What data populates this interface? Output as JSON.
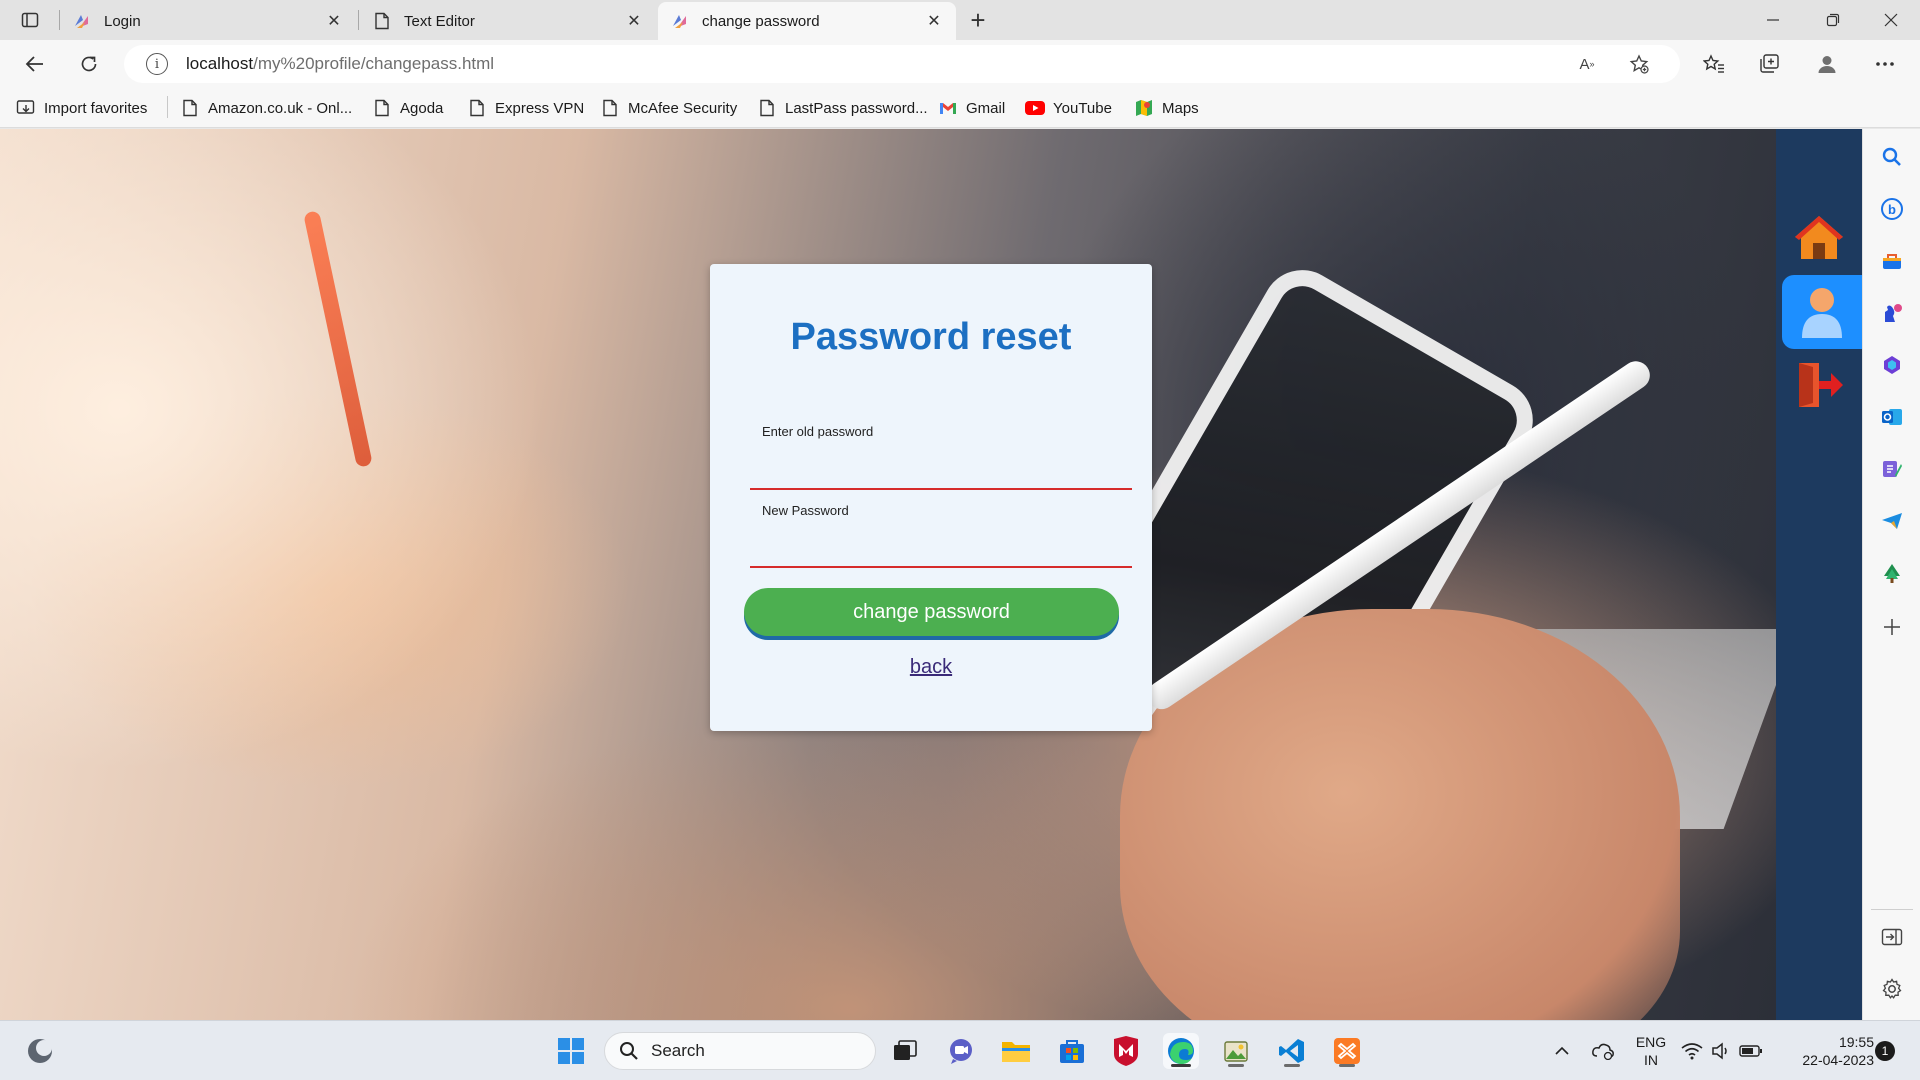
{
  "browser": {
    "tabs": [
      {
        "title": "Login",
        "active": false
      },
      {
        "title": "Text Editor",
        "active": false
      },
      {
        "title": "change password",
        "active": true
      }
    ],
    "address": {
      "host": "localhost",
      "path": "/my%20profile/changepass.html"
    },
    "favorites": [
      {
        "label": "Import favorites",
        "icon": "import-icon"
      },
      {
        "label": "Amazon.co.uk - Onl...",
        "icon": "page-icon"
      },
      {
        "label": "Agoda",
        "icon": "page-icon"
      },
      {
        "label": "Express VPN",
        "icon": "page-icon"
      },
      {
        "label": "McAfee Security",
        "icon": "page-icon"
      },
      {
        "label": "LastPass password...",
        "icon": "page-icon"
      },
      {
        "label": "Gmail",
        "icon": "gmail-icon"
      },
      {
        "label": "YouTube",
        "icon": "youtube-icon"
      },
      {
        "label": "Maps",
        "icon": "maps-icon"
      }
    ]
  },
  "page": {
    "title": "Password reset",
    "old_password_label": "Enter old password",
    "old_password_value": "",
    "new_password_label": "New Password",
    "new_password_value": "",
    "submit_label": "change password",
    "back_label": "back",
    "sidebar_icons": [
      "home-icon",
      "profile-icon",
      "logout-icon"
    ]
  },
  "colors": {
    "title_blue": "#1c6fc2",
    "button_green": "#4caf50",
    "input_underline": "#d62b2b",
    "sidebar_navy": "#1d3a5f",
    "sidebar_active": "#1d8fff"
  },
  "taskbar": {
    "search_label": "Search",
    "language": {
      "line1": "ENG",
      "line2": "IN"
    },
    "time": "19:55",
    "date": "22-04-2023",
    "notification_count": "1"
  }
}
